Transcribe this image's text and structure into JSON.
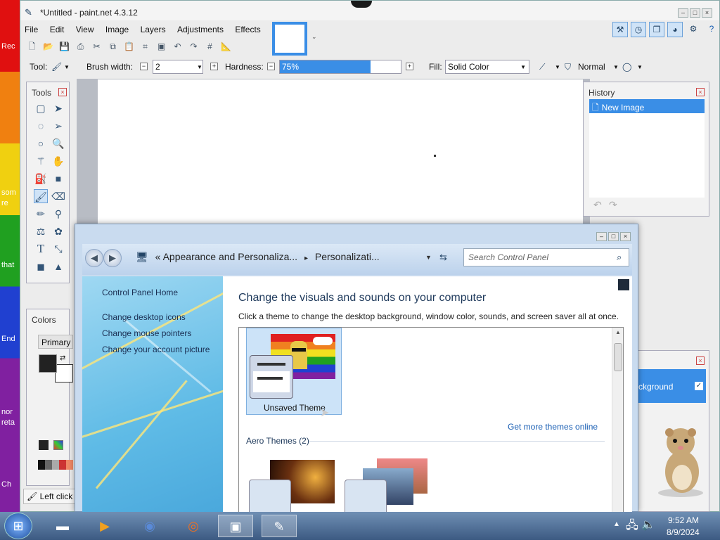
{
  "desktop": {
    "labels": [
      "Rec",
      "som",
      "re",
      "that",
      "End",
      "nor",
      "reta",
      "Ch"
    ]
  },
  "paintnet": {
    "title": "*Untitled - paint.net 4.3.12",
    "menu": [
      "File",
      "Edit",
      "View",
      "Image",
      "Layers",
      "Adjustments",
      "Effects"
    ],
    "toolbar": {
      "tool_label": "Tool:",
      "brush_width_label": "Brush width:",
      "brush_width_value": "2",
      "hardness_label": "Hardness:",
      "hardness_value": "75%",
      "hardness_fraction": 0.75,
      "fill_label": "Fill:",
      "fill_value": "Solid Color",
      "blend_mode": "Normal"
    },
    "tools_panel": {
      "title": "Tools"
    },
    "colors_panel": {
      "title": "Colors",
      "primary_label": "Primary"
    },
    "history_panel": {
      "title": "History",
      "items": [
        "New Image"
      ]
    },
    "layers_panel": {
      "layer_name": "ckground"
    },
    "status": "Left click to"
  },
  "control_panel": {
    "address": [
      "Appearance and Personaliza...",
      "Personalizati..."
    ],
    "search_placeholder": "Search Control Panel",
    "side_links": [
      "Control Panel Home",
      "Change desktop icons",
      "Change mouse pointers",
      "Change your account picture"
    ],
    "heading": "Change the visuals and sounds on your computer",
    "description": "Click a theme to change the desktop background, window color, sounds, and screen saver all at once.",
    "selected_theme": "Unsaved Theme",
    "get_more": "Get more themes online",
    "aero_title": "Aero Themes (2)"
  },
  "taskbar": {
    "time": "9:52 AM",
    "date": "8/9/2024"
  }
}
